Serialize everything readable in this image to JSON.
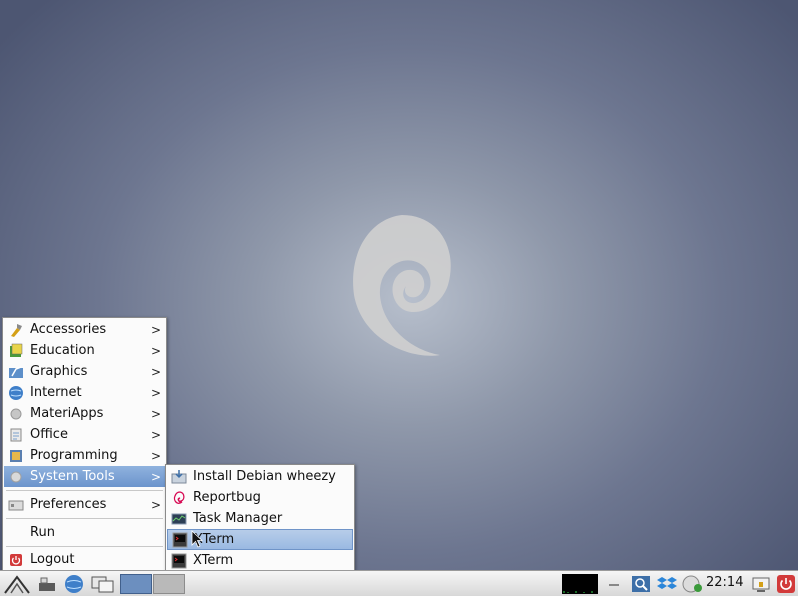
{
  "main_menu": {
    "items": [
      {
        "label": "Accessories",
        "icon": "accessories-icon",
        "submenu": true
      },
      {
        "label": "Education",
        "icon": "education-icon",
        "submenu": true
      },
      {
        "label": "Graphics",
        "icon": "graphics-icon",
        "submenu": true
      },
      {
        "label": "Internet",
        "icon": "internet-icon",
        "submenu": true
      },
      {
        "label": "MateriApps",
        "icon": "materiapps-icon",
        "submenu": true
      },
      {
        "label": "Office",
        "icon": "office-icon",
        "submenu": true
      },
      {
        "label": "Programming",
        "icon": "programming-icon",
        "submenu": true
      },
      {
        "label": "System Tools",
        "icon": "system-tools-icon",
        "submenu": true,
        "selected": true
      },
      {
        "label": "Preferences",
        "icon": "preferences-icon",
        "submenu": true
      },
      {
        "label": "Run",
        "icon": "",
        "submenu": false
      },
      {
        "label": "Logout",
        "icon": "logout-icon",
        "submenu": false
      }
    ],
    "arrow": ">"
  },
  "system_tools_submenu": {
    "items": [
      {
        "label": "Install Debian wheezy",
        "icon": "install-icon"
      },
      {
        "label": "Reportbug",
        "icon": "debian-swirl-icon"
      },
      {
        "label": "Task Manager",
        "icon": "task-manager-icon"
      },
      {
        "label": "XTerm",
        "icon": "terminal-icon",
        "highlighted": true
      },
      {
        "label": "XTerm",
        "icon": "terminal-icon"
      }
    ]
  },
  "taskbar": {
    "clock": "22:14",
    "launchers": [
      "start-menu-icon",
      "show-desktop-icon",
      "web-browser-icon",
      "window-switcher-icon"
    ],
    "tray": [
      "search-icon",
      "dropbox-icon",
      "network-icon",
      "clock",
      "screen-lock-icon",
      "power-icon"
    ]
  },
  "colors": {
    "menu_selected": "#7a9fd3",
    "desktop_center": "#b7bfcc",
    "desktop_edge": "#4d5672"
  }
}
